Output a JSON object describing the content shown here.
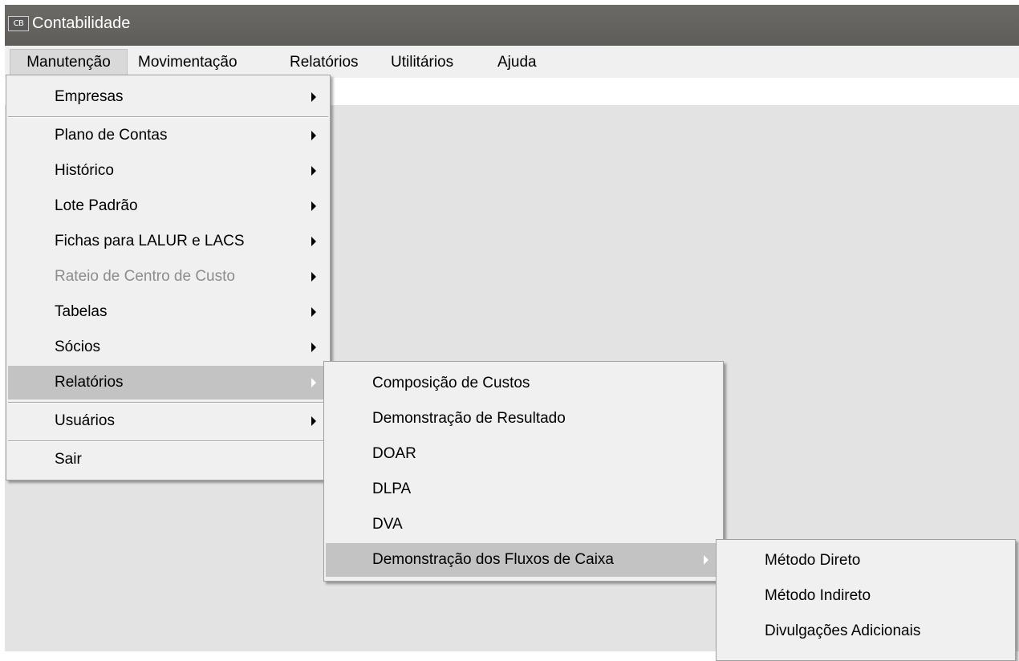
{
  "window": {
    "icon_text": "CB",
    "title": "Contabilidade"
  },
  "menubar": {
    "items": [
      {
        "label": "Manutenção"
      },
      {
        "label": "Movimentação"
      },
      {
        "label": "Relatórios"
      },
      {
        "label": "Utilitários"
      },
      {
        "label": "Ajuda"
      }
    ]
  },
  "manutencao_menu": {
    "items": [
      {
        "label": "Empresas",
        "submenu": true
      },
      {
        "label": "Plano de Contas",
        "submenu": true
      },
      {
        "label": "Histórico",
        "submenu": true
      },
      {
        "label": "Lote Padrão",
        "submenu": true
      },
      {
        "label": "Fichas para LALUR e LACS",
        "submenu": true
      },
      {
        "label": "Rateio de Centro de Custo",
        "submenu": true,
        "disabled": true
      },
      {
        "label": "Tabelas",
        "submenu": true
      },
      {
        "label": "Sócios",
        "submenu": true
      },
      {
        "label": "Relatórios",
        "submenu": true,
        "highlighted": true
      },
      {
        "label": "Usuários",
        "submenu": true
      },
      {
        "label": "Sair",
        "submenu": false
      }
    ]
  },
  "relatorios_submenu": {
    "items": [
      {
        "label": "Composição de Custos"
      },
      {
        "label": "Demonstração de Resultado"
      },
      {
        "label": "DOAR"
      },
      {
        "label": "DLPA"
      },
      {
        "label": "DVA"
      },
      {
        "label": "Demonstração dos Fluxos de Caixa",
        "submenu": true,
        "highlighted": true
      }
    ]
  },
  "fluxos_submenu": {
    "items": [
      {
        "label": "Método Direto"
      },
      {
        "label": "Método Indireto"
      },
      {
        "label": "Divulgações Adicionais"
      }
    ]
  },
  "colors": {
    "titlebar": "#666460",
    "menu_background": "#f0f0f0",
    "highlight": "#c3c3c3",
    "workspace": "#e3e3e3",
    "disabled_text": "#8d8d8d"
  }
}
